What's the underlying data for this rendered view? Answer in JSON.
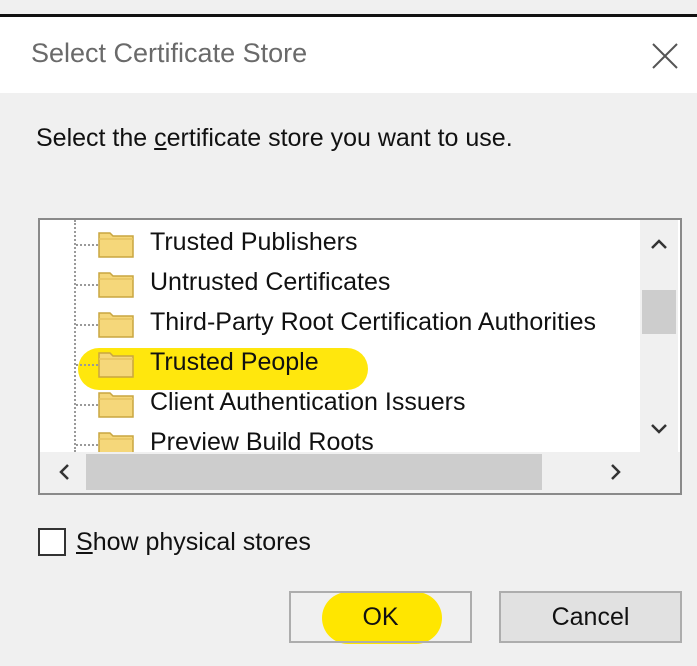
{
  "window": {
    "title": "Select Certificate Store"
  },
  "prompt": {
    "before": "Select the ",
    "underlined": "c",
    "after": "ertificate store you want to use."
  },
  "stores": [
    {
      "label": "Trusted Publishers",
      "highlighted": false
    },
    {
      "label": "Untrusted Certificates",
      "highlighted": false
    },
    {
      "label": "Third-Party Root Certification Authorities",
      "highlighted": false
    },
    {
      "label": "Trusted People",
      "highlighted": true
    },
    {
      "label": "Client Authentication Issuers",
      "highlighted": false
    },
    {
      "label": "Preview Build Roots",
      "highlighted": false
    }
  ],
  "show_physical": {
    "underlined": "S",
    "rest": "how physical stores",
    "checked": false
  },
  "buttons": {
    "ok": "OK",
    "cancel": "Cancel"
  },
  "colors": {
    "highlight": "#ffe600",
    "folder": "#f5d77a"
  }
}
